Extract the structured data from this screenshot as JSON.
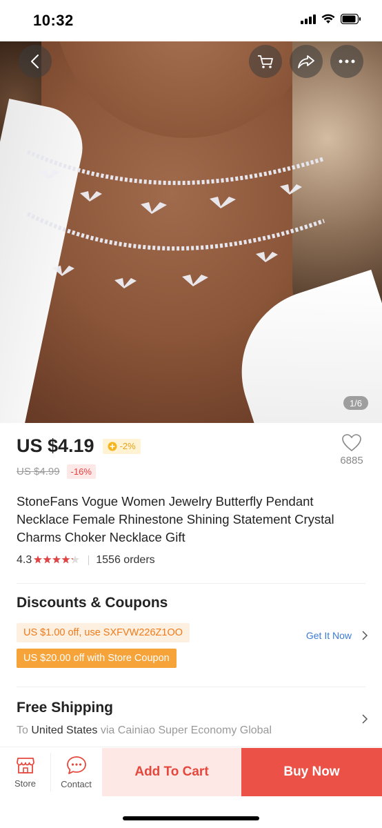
{
  "status_bar": {
    "time": "10:32"
  },
  "gallery": {
    "counter": "1/6",
    "icons": [
      "back-icon",
      "cart-icon",
      "share-icon",
      "more-icon"
    ]
  },
  "product": {
    "price": "US $4.19",
    "coin_discount": "-2%",
    "original_price": "US $4.99",
    "discount": "-16%",
    "wishlist_count": "6885",
    "title": "StoneFans Vogue Women Jewelry Butterfly Pendant Necklace Female Rhinestone Shining Statement Crystal Charms Choker Necklace Gift",
    "rating": "4.3",
    "rating_fraction": 0.86,
    "orders": "1556 orders"
  },
  "coupons": {
    "title": "Discounts & Coupons",
    "coupon1": "US $1.00 off, use SXFVW226Z1OO",
    "coupon2": "US $20.00 off with Store Coupon",
    "get_it": "Get It Now"
  },
  "shipping": {
    "title": "Free Shipping",
    "to_prefix": "To",
    "destination": "United States",
    "via": "via Cainiao Super Economy Global"
  },
  "bottom_bar": {
    "store": "Store",
    "contact": "Contact",
    "add_to_cart": "Add To Cart",
    "buy_now": "Buy Now"
  },
  "colors": {
    "accent_red": "#ec5148",
    "coupon_orange": "#f6a33a",
    "link_blue": "#3a7bd5"
  }
}
